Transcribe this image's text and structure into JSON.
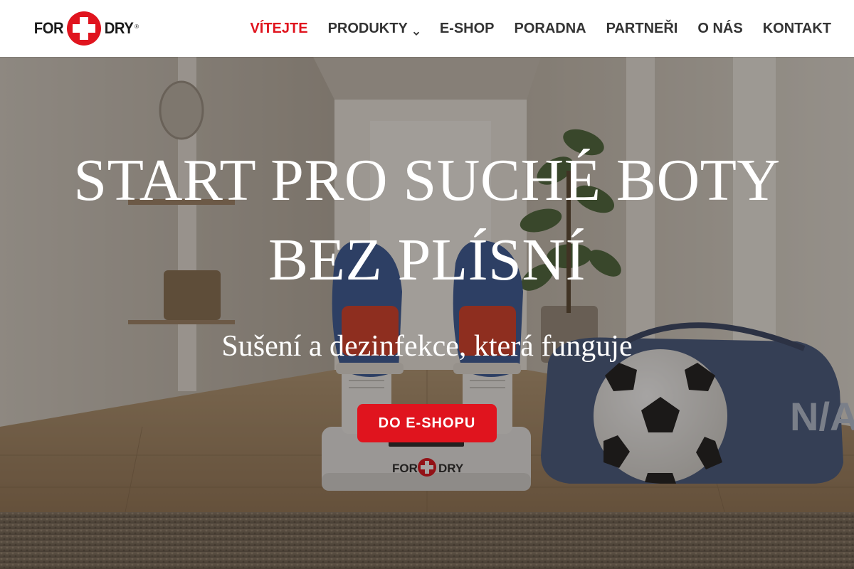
{
  "header": {
    "logo": {
      "word_left": "FOR",
      "word_right": "DRY",
      "registered": "®"
    },
    "nav": [
      {
        "label": "VÍTEJTE",
        "active": true
      },
      {
        "label": "PRODUKTY",
        "has_dropdown": true
      },
      {
        "label": "E-SHOP"
      },
      {
        "label": "PORADNA"
      },
      {
        "label": "PARTNEŘI"
      },
      {
        "label": "O NÁS"
      },
      {
        "label": "KONTAKT"
      }
    ]
  },
  "hero": {
    "title_line1": "START PRO SUCHÉ BOTY",
    "title_line2": "BEZ PLÍSNÍ",
    "subtitle": "Sušení a dezinfekce, která funguje",
    "cta_label": "DO E-SHOPU",
    "device_logo": {
      "word_left": "FOR",
      "word_right": "DRY"
    },
    "bag_text": "N/A"
  },
  "colors": {
    "brand_red": "#e0141e",
    "nav_text": "#333333",
    "header_bg": "#ffffff"
  }
}
